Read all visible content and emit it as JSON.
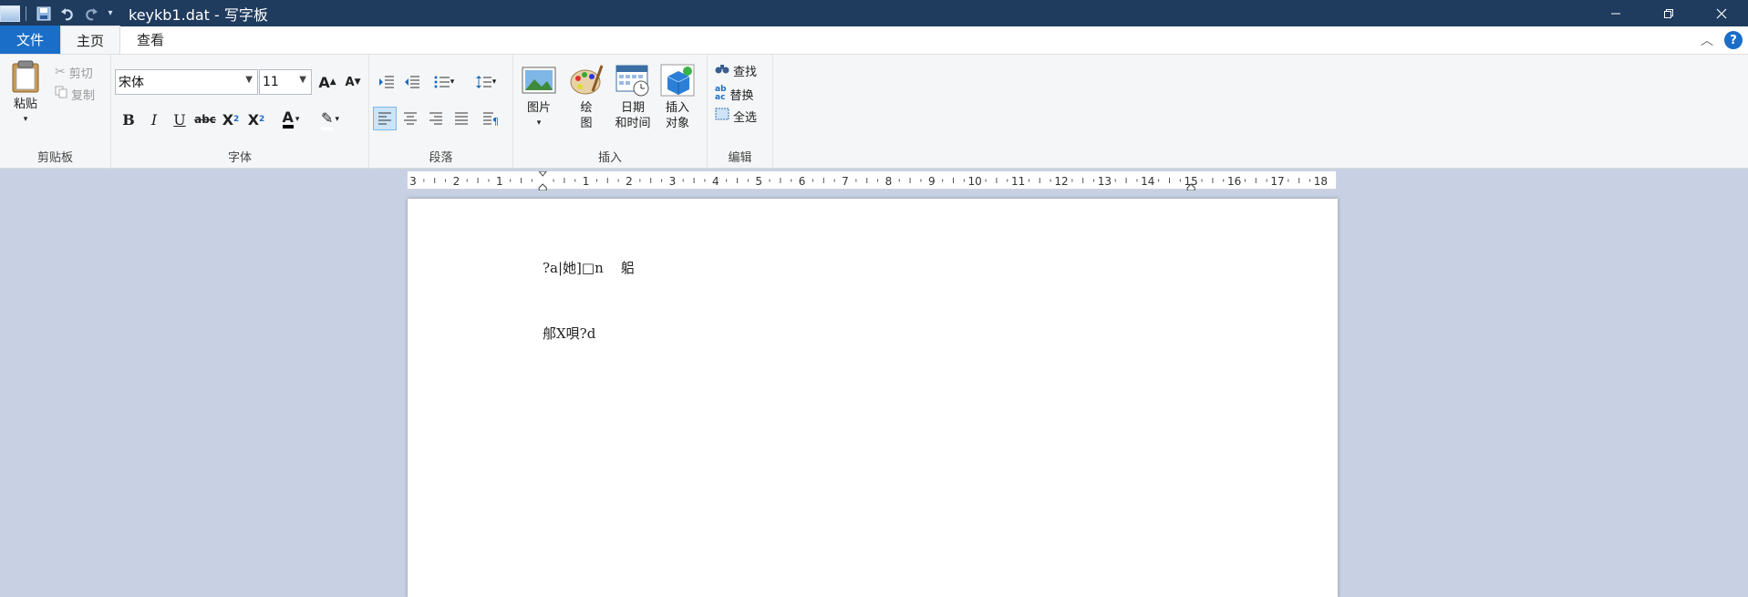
{
  "window": {
    "title": "keykb1.dat - 写字板"
  },
  "tabs": [
    {
      "label": "文件"
    },
    {
      "label": "主页"
    },
    {
      "label": "查看"
    }
  ],
  "help": {
    "label": "?"
  },
  "ribbon": {
    "clipboard": {
      "label": "剪贴板",
      "paste": "粘贴",
      "cut": "剪切",
      "copy": "复制"
    },
    "font": {
      "label": "字体",
      "family": "宋体",
      "size": "11"
    },
    "paragraph": {
      "label": "段落"
    },
    "insert": {
      "label": "插入",
      "picture": "图片",
      "paint_line1": "绘",
      "paint_line2": "图",
      "datetime_line1": "日期",
      "datetime_line2": "和时间",
      "object_line1": "插入",
      "object_line2": "对象"
    },
    "editing": {
      "label": "编辑",
      "find": "查找",
      "replace": "替换",
      "select_all": "全选"
    }
  },
  "ruler": {
    "labels": [
      "3",
      "2",
      "1",
      "",
      "1",
      "2",
      "3",
      "4",
      "5",
      "6",
      "7",
      "8",
      "9",
      "10",
      "11",
      "12",
      "13",
      "14",
      "15",
      "16",
      "17",
      "18"
    ]
  },
  "document": {
    "lines": [
      "?a|她]□n    躳",
      "郍X唄?d"
    ]
  },
  "colors": {
    "titlebar": "#1f3b5e",
    "file_tab": "#1a6ec7",
    "workspace": "#c7d1e3"
  }
}
